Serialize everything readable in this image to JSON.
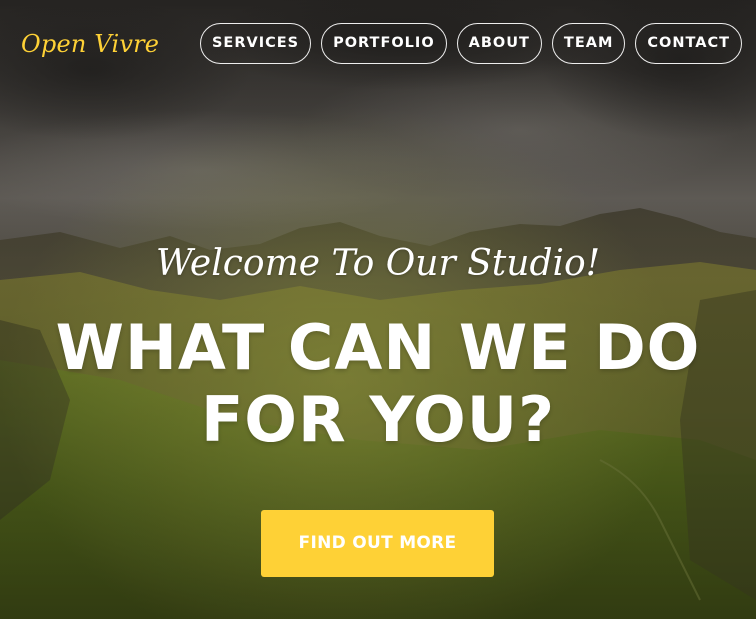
{
  "brand": {
    "name": "Open Vivre"
  },
  "nav": {
    "items": [
      {
        "label": "SERVICES"
      },
      {
        "label": "PORTFOLIO"
      },
      {
        "label": "ABOUT"
      },
      {
        "label": "TEAM"
      },
      {
        "label": "CONTACT"
      }
    ]
  },
  "hero": {
    "lead_in": "Welcome To Our Studio!",
    "heading_line1": "WHAT CAN WE DO",
    "heading_line2": "FOR YOU?",
    "cta_label": "FIND OUT MORE",
    "background": "cloudy sky over green mountain valley"
  },
  "colors": {
    "accent": "#fed136",
    "text": "#ffffff"
  }
}
